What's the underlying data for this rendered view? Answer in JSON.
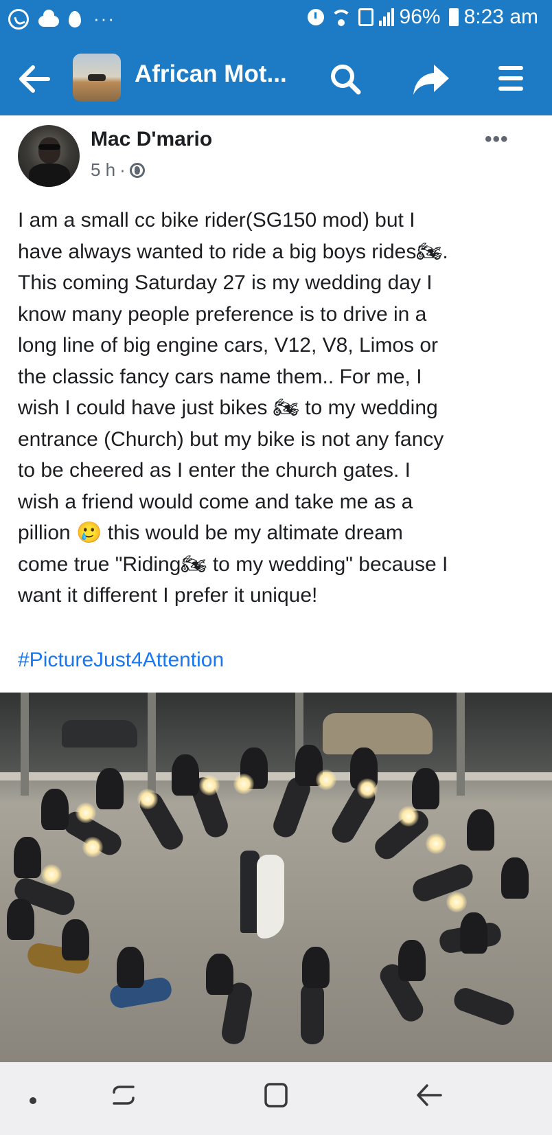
{
  "status_bar": {
    "battery": "96%",
    "time": "8:23 am",
    "more_indicator": "···"
  },
  "app_bar": {
    "title": "African Mot...",
    "accent_color": "#1d7bc6"
  },
  "post": {
    "author": "Mac D'mario",
    "time_ago": "5 h",
    "separator": "·",
    "more_label": "•••",
    "body": "I am a small cc bike rider(SG150 mod) but I\nhave always wanted to ride a big boys rides🏍.\nThis coming Saturday 27 is my wedding day I\nknow many people preference is to drive in a\nlong line of big engine cars, V12, V8, Limos or\nthe classic fancy cars name them.. For me, I\nwish I could have just bikes 🏍 to my wedding\nentrance (Church) but my bike is not any fancy\nto be cheered as I enter the church gates. I\nwish a friend would come and take me as a\npillion 🥲 this would be my altimate dream\ncome true \"Riding🏍 to my wedding\" because I\nwant it different I prefer it unique!",
    "hashtag": "#PictureJust4Attention",
    "hashtag_color": "#1877f2"
  },
  "icons": {
    "status_left": [
      "whatsapp-icon",
      "cloud-icon",
      "fire-icon"
    ],
    "status_right": [
      "alarm-icon",
      "wifi-icon",
      "sim-icon",
      "signal-icon",
      "battery-icon"
    ],
    "app_bar": [
      "back-arrow-icon",
      "search-icon",
      "share-icon",
      "menu-icon"
    ],
    "nav_bar": [
      "recents-icon",
      "home-icon",
      "back-icon"
    ]
  }
}
